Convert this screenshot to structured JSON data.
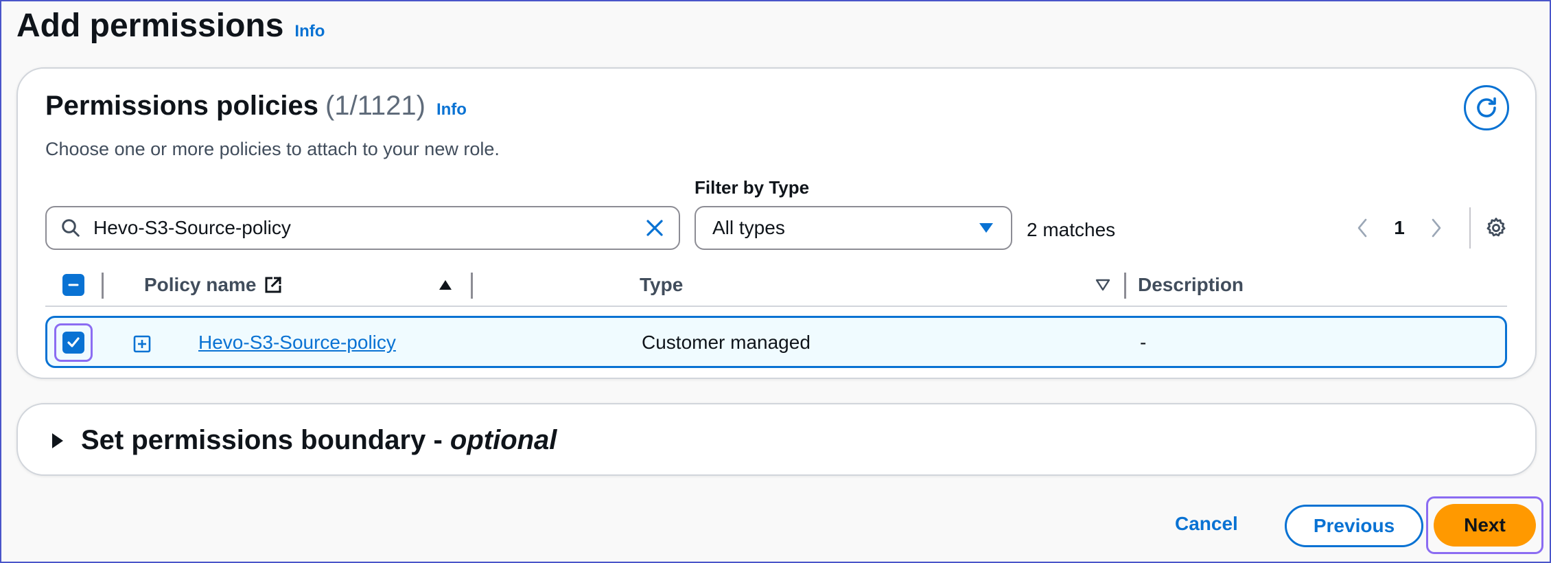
{
  "page": {
    "title": "Add permissions",
    "info_label": "Info"
  },
  "policies": {
    "title": "Permissions policies",
    "count": "(1/1121)",
    "info_label": "Info",
    "description": "Choose one or more policies to attach to your new role.",
    "search_value": "Hevo-S3-Source-policy",
    "filter_label": "Filter by Type",
    "filter_selected": "All types",
    "matches": "2 matches",
    "page_number": "1",
    "columns": {
      "policy_name": "Policy name",
      "type": "Type",
      "description": "Description"
    },
    "rows": [
      {
        "name": "Hevo-S3-Source-policy",
        "type": "Customer managed",
        "description": "-",
        "selected": true
      }
    ]
  },
  "boundary": {
    "title": "Set permissions boundary - ",
    "title_optional": "optional"
  },
  "footer": {
    "cancel": "Cancel",
    "previous": "Previous",
    "next": "Next"
  },
  "colors": {
    "accent": "#0972d3",
    "primary_button": "#ff9900",
    "highlight_frame": "#8b6cf2",
    "selected_row_bg": "#f0fbff"
  },
  "icons": [
    "search-icon",
    "close-icon",
    "caret-down-icon",
    "chevron-left-icon",
    "chevron-right-icon",
    "gear-icon",
    "refresh-icon",
    "external-link-icon",
    "sort-ascending-icon",
    "sort-descending-icon",
    "plus-square-icon",
    "caret-right-icon",
    "checkbox-indeterminate-icon",
    "checkbox-checked-icon"
  ]
}
